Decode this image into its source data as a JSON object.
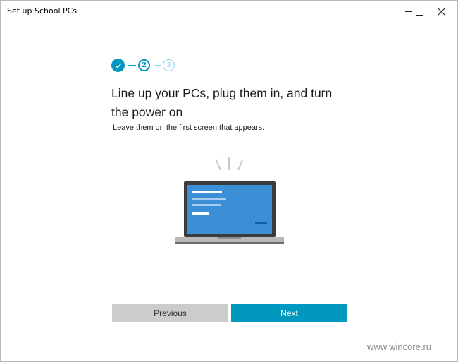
{
  "window": {
    "title": "Set up School PCs",
    "controls": [
      "minimize-icon",
      "maximize-icon",
      "close-icon"
    ]
  },
  "stepper": {
    "steps": [
      {
        "label": "✓",
        "state": "completed"
      },
      {
        "label": "2",
        "state": "current"
      },
      {
        "label": "3",
        "state": "upcoming"
      }
    ],
    "colors": {
      "active": "#0098bf",
      "inactive": "#8fd0e6"
    }
  },
  "main": {
    "heading": "Line up your PCs, plug them in, and turn the power on",
    "subtext": "Leave them on the first screen that appears.",
    "illustration": "laptop-icon"
  },
  "buttons": {
    "previous": "Previous",
    "next": "Next"
  },
  "watermark": "www.wincore.ru",
  "colors": {
    "accent": "#0098bf",
    "secondary_button": "#cccccc",
    "screen_blue": "#3a8fd6"
  }
}
